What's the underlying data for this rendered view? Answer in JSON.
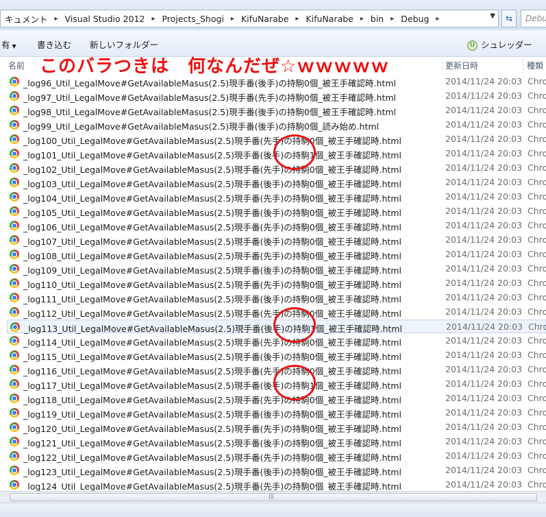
{
  "address": {
    "crumbs": [
      "キュメント",
      "Visual Studio 2012",
      "Projects_Shogi",
      "KifuNarabe",
      "KifuNarabe",
      "bin",
      "Debug"
    ],
    "dropdown_icon": "chevron-down-icon",
    "refresh_icon": "refresh-icon",
    "search_placeholder": "Debu"
  },
  "toolbar": {
    "organize": "有",
    "burn": "書き込む",
    "new_folder": "新しいフォルダー",
    "shredder": "シュレッダー"
  },
  "annotation": "このバラつきは　何なんだぜ☆ｗｗｗｗｗ",
  "columns": {
    "name": "名前",
    "date": "更新日時",
    "type": "種類"
  },
  "files": [
    {
      "name": "_log96_Util_LegalMove#GetAvailableMasus(2.5)現手番(後手)の持駒0個_被王手確認時.html",
      "date": "2014/11/24 20:03",
      "type": "Chro"
    },
    {
      "name": "_log97_Util_LegalMove#GetAvailableMasus(2.5)現手番(先手)の持駒0個_被王手確認時.html",
      "date": "2014/11/24 20:03",
      "type": "Chro"
    },
    {
      "name": "_log98_Util_LegalMove#GetAvailableMasus(2.5)現手番(後手)の持駒0個_被王手確認時.html",
      "date": "2014/11/24 20:03",
      "type": "Chro"
    },
    {
      "name": "_log99_Util_LegalMove#GetAvailableMasus(2.5)現手番(後手)の持駒0個_読み始め.html",
      "date": "2014/11/24 20:03",
      "type": "Chro"
    },
    {
      "name": "_log100_Util_LegalMove#GetAvailableMasus(2.5)現手番(先手)の持駒0個_被王手確認時.html",
      "date": "2014/11/24 20:03",
      "type": "Chro"
    },
    {
      "name": "_log101_Util_LegalMove#GetAvailableMasus(2.5)現手番(後手)の持駒1個_被王手確認時.html",
      "date": "2014/11/24 20:03",
      "type": "Chro"
    },
    {
      "name": "_log102_Util_LegalMove#GetAvailableMasus(2.5)現手番(先手)の持駒0個_被王手確認時.html",
      "date": "2014/11/24 20:03",
      "type": "Chro"
    },
    {
      "name": "_log103_Util_LegalMove#GetAvailableMasus(2.5)現手番(後手)の持駒0個_被王手確認時.html",
      "date": "2014/11/24 20:03",
      "type": "Chro"
    },
    {
      "name": "_log104_Util_LegalMove#GetAvailableMasus(2.5)現手番(先手)の持駒0個_被王手確認時.html",
      "date": "2014/11/24 20:03",
      "type": "Chro"
    },
    {
      "name": "_log105_Util_LegalMove#GetAvailableMasus(2.5)現手番(後手)の持駒0個_被王手確認時.html",
      "date": "2014/11/24 20:03",
      "type": "Chro"
    },
    {
      "name": "_log106_Util_LegalMove#GetAvailableMasus(2.5)現手番(先手)の持駒0個_被王手確認時.html",
      "date": "2014/11/24 20:03",
      "type": "Chro"
    },
    {
      "name": "_log107_Util_LegalMove#GetAvailableMasus(2.5)現手番(後手)の持駒0個_被王手確認時.html",
      "date": "2014/11/24 20:03",
      "type": "Chro"
    },
    {
      "name": "_log108_Util_LegalMove#GetAvailableMasus(2.5)現手番(先手)の持駒0個_被王手確認時.html",
      "date": "2014/11/24 20:03",
      "type": "Chro"
    },
    {
      "name": "_log109_Util_LegalMove#GetAvailableMasus(2.5)現手番(後手)の持駒0個_被王手確認時.html",
      "date": "2014/11/24 20:03",
      "type": "Chro"
    },
    {
      "name": "_log110_Util_LegalMove#GetAvailableMasus(2.5)現手番(先手)の持駒0個_被王手確認時.html",
      "date": "2014/11/24 20:03",
      "type": "Chro"
    },
    {
      "name": "_log111_Util_LegalMove#GetAvailableMasus(2.5)現手番(後手)の持駒0個_被王手確認時.html",
      "date": "2014/11/24 20:03",
      "type": "Chro"
    },
    {
      "name": "_log112_Util_LegalMove#GetAvailableMasus(2.5)現手番(先手)の持駒0個_被王手確認時.html",
      "date": "2014/11/24 20:03",
      "type": "Chro"
    },
    {
      "name": "_log113_Util_LegalMove#GetAvailableMasus(2.5)現手番(後手)の持駒1個_被王手確認時.html",
      "date": "2014/11/24 20:03",
      "type": "Chro"
    },
    {
      "name": "_log114_Util_LegalMove#GetAvailableMasus(2.5)現手番(先手)の持駒0個_被王手確認時.html",
      "date": "2014/11/24 20:03",
      "type": "Chro"
    },
    {
      "name": "_log115_Util_LegalMove#GetAvailableMasus(2.5)現手番(後手)の持駒0個_被王手確認時.html",
      "date": "2014/11/24 20:03",
      "type": "Chro"
    },
    {
      "name": "_log116_Util_LegalMove#GetAvailableMasus(2.5)現手番(先手)の持駒0個_被王手確認時.html",
      "date": "2014/11/24 20:03",
      "type": "Chro"
    },
    {
      "name": "_log117_Util_LegalMove#GetAvailableMasus(2.5)現手番(後手)の持駒1個_被王手確認時.html",
      "date": "2014/11/24 20:03",
      "type": "Chro"
    },
    {
      "name": "_log118_Util_LegalMove#GetAvailableMasus(2.5)現手番(先手)の持駒0個_被王手確認時.html",
      "date": "2014/11/24 20:03",
      "type": "Chro"
    },
    {
      "name": "_log119_Util_LegalMove#GetAvailableMasus(2.5)現手番(後手)の持駒0個_被王手確認時.html",
      "date": "2014/11/24 20:03",
      "type": "Chro"
    },
    {
      "name": "_log120_Util_LegalMove#GetAvailableMasus(2.5)現手番(先手)の持駒0個_被王手確認時.html",
      "date": "2014/11/24 20:03",
      "type": "Chro"
    },
    {
      "name": "_log121_Util_LegalMove#GetAvailableMasus(2.5)現手番(後手)の持駒0個_被王手確認時.html",
      "date": "2014/11/24 20:03",
      "type": "Chro"
    },
    {
      "name": "_log122_Util_LegalMove#GetAvailableMasus(2.5)現手番(先手)の持駒0個_被王手確認時.html",
      "date": "2014/11/24 20:03",
      "type": "Chro"
    },
    {
      "name": "_log123_Util_LegalMove#GetAvailableMasus(2.5)現手番(後手)の持駒0個_被王手確認時.html",
      "date": "2014/11/24 20:03",
      "type": "Chro"
    },
    {
      "name": "_log124_Util_LegalMove#GetAvailableMasus(2.5)現手番(先手)の持駒0個_被王手確認時.html",
      "date": "2014/11/24 20:03",
      "type": "Chro"
    }
  ],
  "selected_row": 17,
  "highlight_color": "#e81616",
  "file_icon": "chrome-icon"
}
